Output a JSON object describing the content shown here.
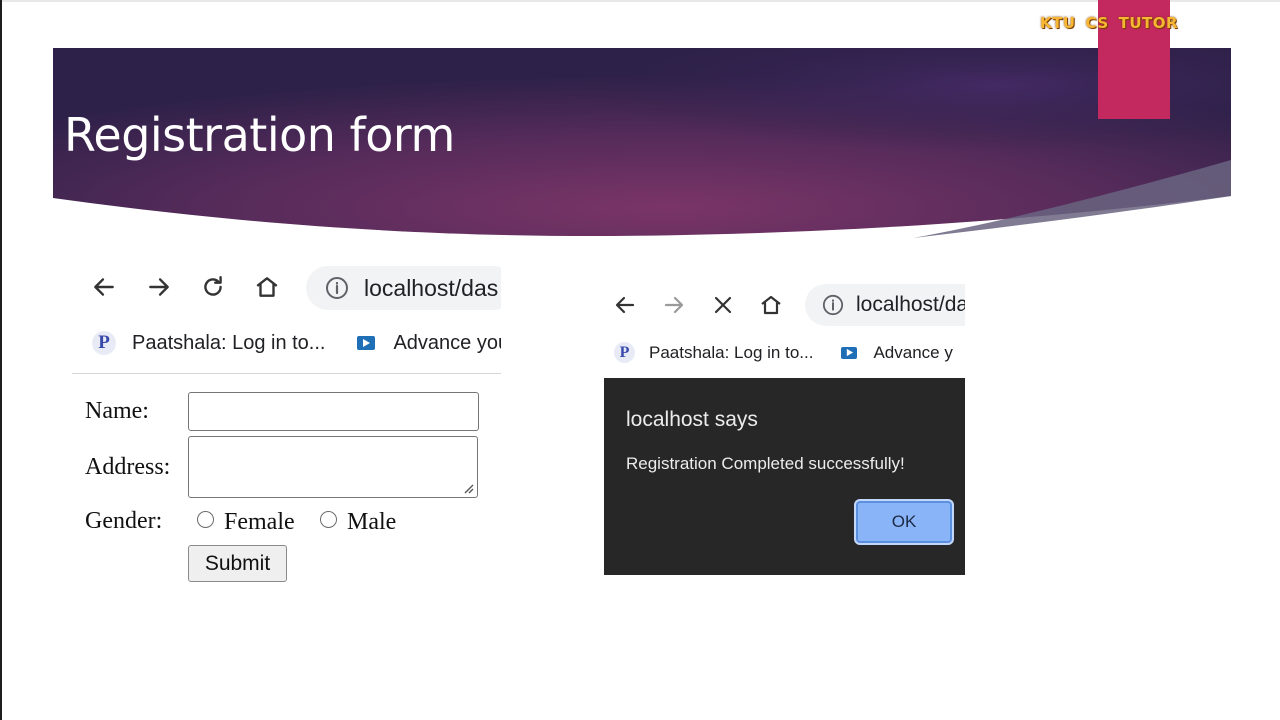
{
  "brand": {
    "parts": [
      "KTU",
      "CS",
      "TUTOR"
    ],
    "accent_color": "#c3285f",
    "text_color": "#f7b733"
  },
  "slide": {
    "title": "Registration form"
  },
  "left_browser": {
    "nav_icons": [
      "back-arrow-icon",
      "forward-arrow-icon",
      "reload-icon",
      "home-icon"
    ],
    "address": "localhost/das",
    "bookmarks": [
      {
        "icon": "paatshala-icon",
        "icon_letter": "P",
        "label": "Paatshala: Log in to..."
      },
      {
        "icon": "video-bookmark-icon",
        "label": "Advance you"
      }
    ]
  },
  "form": {
    "name_label": "Name:",
    "name_value": "",
    "address_label": "Address:",
    "address_value": "",
    "gender_label": "Gender:",
    "gender_options": [
      "Female",
      "Male"
    ],
    "submit_label": "Submit"
  },
  "right_browser": {
    "nav_icons": [
      "back-arrow-icon",
      "forward-arrow-icon",
      "stop-loading-icon",
      "home-icon"
    ],
    "address": "localhost/da",
    "bookmarks": [
      {
        "icon": "paatshala-icon",
        "icon_letter": "P",
        "label": "Paatshala: Log in to..."
      },
      {
        "icon": "video-bookmark-icon",
        "label": "Advance y"
      }
    ]
  },
  "dialog": {
    "title": "localhost says",
    "message": "Registration Completed successfully!",
    "ok_label": "OK"
  }
}
